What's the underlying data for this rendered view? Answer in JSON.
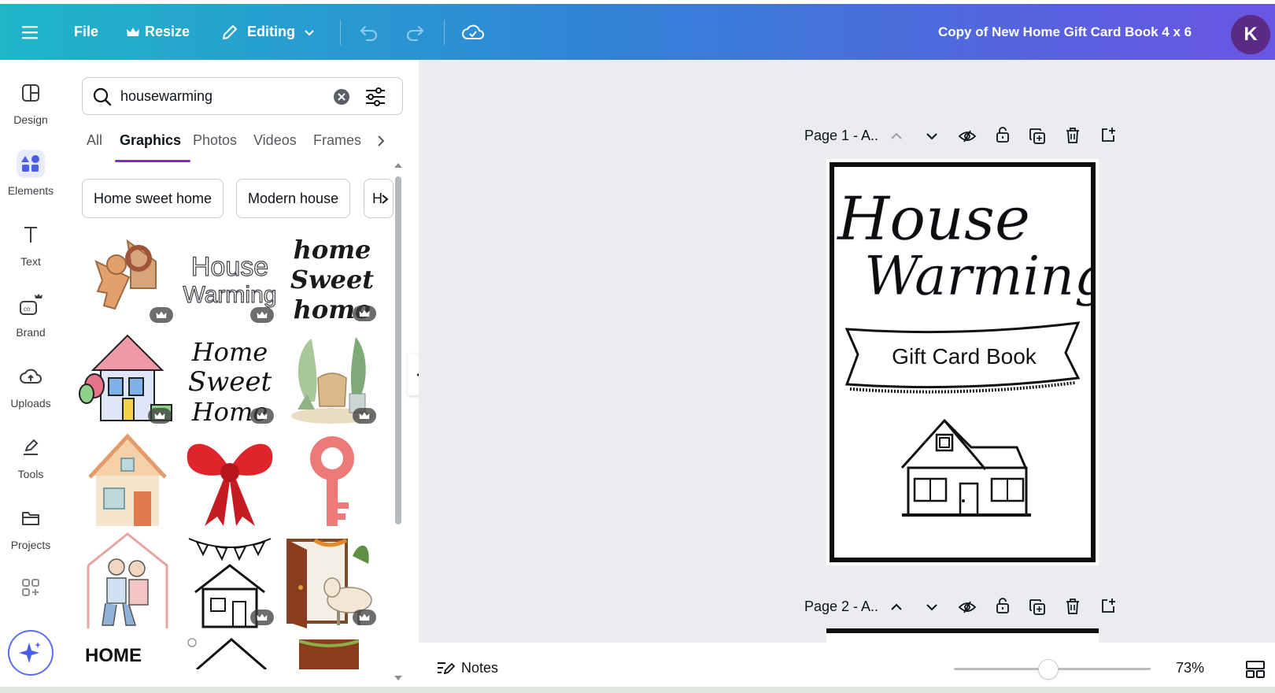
{
  "topbar": {
    "file_label": "File",
    "resize_label": "Resize",
    "editing_label": "Editing",
    "doc_title": "Copy of New Home Gift Card Book 4 x 6",
    "avatar_initial": "K",
    "brand_color": "#2f86d6"
  },
  "rail": {
    "items": [
      {
        "label": "Design",
        "icon": "layout-icon"
      },
      {
        "label": "Elements",
        "icon": "shapes-icon"
      },
      {
        "label": "Text",
        "icon": "text-icon"
      },
      {
        "label": "Brand",
        "icon": "brand-icon"
      },
      {
        "label": "Uploads",
        "icon": "cloud-upload-icon"
      },
      {
        "label": "Tools",
        "icon": "pen-tool-icon"
      },
      {
        "label": "Projects",
        "icon": "folder-icon"
      }
    ],
    "active": "Elements"
  },
  "panel": {
    "search_value": "housewarming",
    "tabs": [
      "All",
      "Graphics",
      "Photos",
      "Videos",
      "Frames"
    ],
    "active_tab": "Graphics",
    "chips": [
      "Home sweet home",
      "Modern house",
      "H"
    ],
    "graphics": [
      {
        "name": "keys-with-house-tag",
        "pro": true
      },
      {
        "name": "house-warming-lettering",
        "pro": true
      },
      {
        "name": "home-sweet-home-script",
        "pro": true
      },
      {
        "name": "house-with-balloons",
        "pro": true
      },
      {
        "name": "home-sweet-home-handlettering",
        "pro": true
      },
      {
        "name": "plants-and-chair",
        "pro": true
      },
      {
        "name": "watercolor-house",
        "pro": false
      },
      {
        "name": "red-bow",
        "pro": false
      },
      {
        "name": "pink-key",
        "pro": false
      },
      {
        "name": "couple-in-house",
        "pro": false
      },
      {
        "name": "bunting-house-outline",
        "pro": true
      },
      {
        "name": "door-with-cow",
        "pro": true
      }
    ]
  },
  "canvas": {
    "page1_label": "Page 1 - A..",
    "page2_label": "Page 2 - A..",
    "design_title_line1": "House",
    "design_title_line2": "Warming",
    "design_banner": "Gift Card Book"
  },
  "footer": {
    "notes_label": "Notes",
    "zoom_percent": "73%",
    "zoom_level": 0.48
  }
}
